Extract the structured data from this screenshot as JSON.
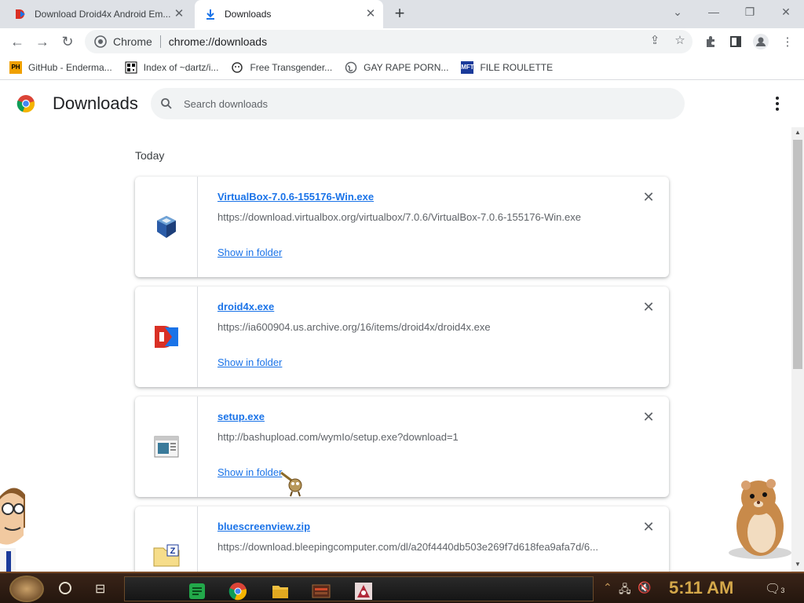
{
  "tabs": [
    {
      "title": "Download Droid4x Android Em...",
      "active": false
    },
    {
      "title": "Downloads",
      "active": true
    }
  ],
  "toolbar": {
    "site_chip": "Chrome",
    "url": "chrome://downloads"
  },
  "bookmarks": [
    {
      "label": "GitHub - Enderma...",
      "icon": "ph-icon"
    },
    {
      "label": "Index of ~dartz/i...",
      "icon": "qr-icon"
    },
    {
      "label": "Free Transgender...",
      "icon": "mask-icon"
    },
    {
      "label": "GAY RAPE PORN...",
      "icon": "globe-icon"
    },
    {
      "label": "FILE ROULETTE",
      "icon": "mft-icon"
    }
  ],
  "downloads_page": {
    "title": "Downloads",
    "search_placeholder": "Search downloads",
    "section_label": "Today",
    "items": [
      {
        "filename": "VirtualBox-7.0.6-155176-Win.exe",
        "url": "https://download.virtualbox.org/virtualbox/7.0.6/VirtualBox-7.0.6-155176-Win.exe",
        "action": "Show in folder",
        "icon": "virtualbox-icon"
      },
      {
        "filename": "droid4x.exe",
        "url": "https://ia600904.us.archive.org/16/items/droid4x/droid4x.exe",
        "action": "Show in folder",
        "icon": "droid4x-icon"
      },
      {
        "filename": "setup.exe",
        "url": "http://bashupload.com/wymIo/setup.exe?download=1",
        "action": "Show in folder",
        "icon": "setup-icon"
      },
      {
        "filename": "bluescreenview.zip",
        "url": "https://download.bleepingcomputer.com/dl/a20f4440db503e269f7d618fea9afa7d/6...",
        "action": "Show in folder",
        "icon": "zip-icon"
      }
    ]
  },
  "taskbar": {
    "clock": "5:11 AM",
    "notification_count": "3"
  },
  "colors": {
    "accent": "#1a73e8",
    "tab_strip": "#dee1e6",
    "taskbar": "#2a1a10",
    "clock": "#d4a84a"
  }
}
